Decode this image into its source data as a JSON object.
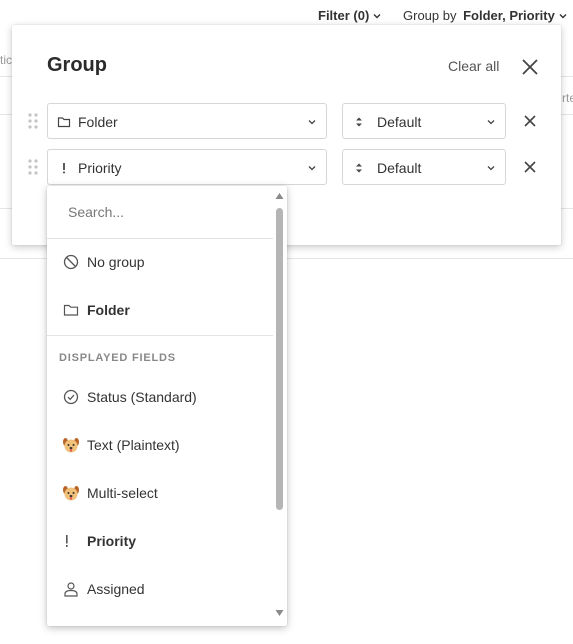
{
  "topbar": {
    "filter_label": "Filter (0)",
    "groupby_prefix": "Group by ",
    "groupby_value": "Folder, Priority"
  },
  "background": {
    "left_fragment": "tic",
    "right_fragment": "rte"
  },
  "panel": {
    "title": "Group",
    "clear_all": "Clear all",
    "rows": [
      {
        "field": "Folder",
        "field_icon": "folder-icon",
        "sort": "Default"
      },
      {
        "field": "Priority",
        "field_icon": "priority-icon",
        "sort": "Default"
      }
    ]
  },
  "dropdown": {
    "search_placeholder": "Search...",
    "options_top": [
      {
        "label": "No group",
        "icon": "no-group-icon"
      },
      {
        "label": "Folder",
        "icon": "folder-icon"
      }
    ],
    "section_label": "DISPLAYED FIELDS",
    "fields": [
      {
        "label": "Status (Standard)",
        "icon": "status-check-icon"
      },
      {
        "label": "Text (Plaintext)",
        "icon": "dog-emoji-icon"
      },
      {
        "label": "Multi-select",
        "icon": "dog-emoji-icon"
      },
      {
        "label": "Priority",
        "icon": "priority-icon"
      },
      {
        "label": "Assigned",
        "icon": "person-icon"
      }
    ]
  },
  "colors": {
    "text": "#333333",
    "muted": "#888888",
    "border": "#d6d6d6",
    "scrollbar": "#b5b5b5"
  }
}
